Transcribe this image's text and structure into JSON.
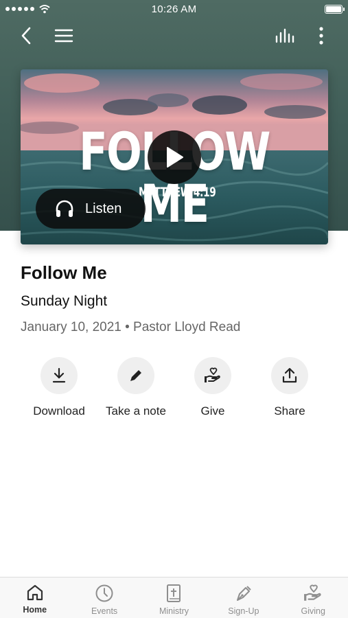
{
  "status_bar": {
    "time": "10:26 AM"
  },
  "media": {
    "art_title": "FOLLOW ME",
    "art_subtitle": "MATTHEW 4:19",
    "listen_label": "Listen"
  },
  "sermon": {
    "title": "Follow Me",
    "series": "Sunday Night",
    "meta": "January 10, 2021 • Pastor Lloyd Read"
  },
  "actions": [
    {
      "label": "Download",
      "icon": "download-icon"
    },
    {
      "label": "Take a note",
      "icon": "pencil-icon"
    },
    {
      "label": "Give",
      "icon": "give-icon"
    },
    {
      "label": "Share",
      "icon": "share-icon"
    }
  ],
  "tabs": [
    {
      "label": "Home",
      "icon": "home-icon",
      "active": true
    },
    {
      "label": "Events",
      "icon": "clock-icon",
      "active": false
    },
    {
      "label": "Ministry",
      "icon": "bible-icon",
      "active": false
    },
    {
      "label": "Sign-Up",
      "icon": "pen-icon",
      "active": false
    },
    {
      "label": "Giving",
      "icon": "give-icon",
      "active": false
    }
  ],
  "colors": {
    "header_bg": "#3f5d57",
    "muted_text": "#666666",
    "action_circle": "#efefef",
    "active_tab": "#333333",
    "inactive_tab": "#8e8e8e"
  }
}
